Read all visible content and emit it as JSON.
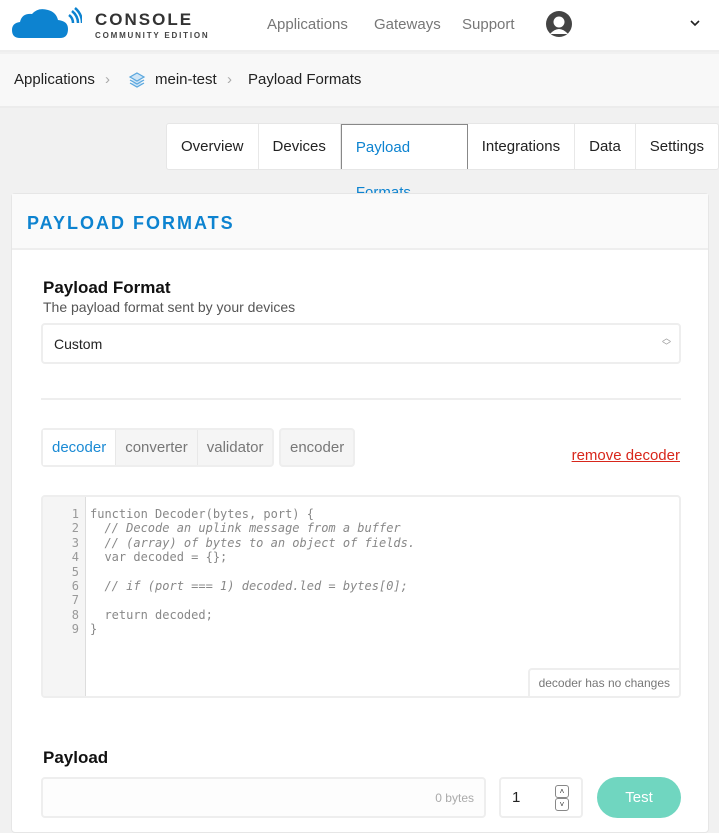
{
  "brand": {
    "title": "CONSOLE",
    "subtitle": "COMMUNITY EDITION",
    "color": "#0d83d0"
  },
  "nav": {
    "items": [
      "Applications",
      "Gateways",
      "Support"
    ],
    "avatar_icon": "user-avatar-icon",
    "menu_icon": "chevron-down-icon"
  },
  "breadcrumb": {
    "items": [
      "Applications",
      "mein-test",
      "Payload Formats"
    ],
    "app_icon": "layers-icon"
  },
  "tabs": [
    "Overview",
    "Devices",
    "Payload Formats",
    "Integrations",
    "Data",
    "Settings"
  ],
  "active_tab": "Payload Formats",
  "card": {
    "title": "PAYLOAD FORMATS"
  },
  "format": {
    "label": "Payload Format",
    "description": "The payload format sent by your devices",
    "selected": "Custom"
  },
  "functions": {
    "tabs": [
      "decoder",
      "converter",
      "validator"
    ],
    "encoder": "encoder",
    "active": "decoder",
    "remove": "remove decoder"
  },
  "editor": {
    "lines": [
      {
        "n": "1",
        "t": "function Decoder(bytes, port) {",
        "c": false
      },
      {
        "n": "2",
        "t": "  // Decode an uplink message from a buffer",
        "c": true
      },
      {
        "n": "3",
        "t": "  // (array) of bytes to an object of fields.",
        "c": true
      },
      {
        "n": "4",
        "t": "  var decoded = {};",
        "c": false
      },
      {
        "n": "5",
        "t": "",
        "c": false
      },
      {
        "n": "6",
        "t": "  // if (port === 1) decoded.led = bytes[0];",
        "c": true
      },
      {
        "n": "7",
        "t": "",
        "c": false
      },
      {
        "n": "8",
        "t": "  return decoded;",
        "c": false
      },
      {
        "n": "9",
        "t": "}",
        "c": false
      }
    ],
    "status": "decoder has no changes"
  },
  "payload": {
    "label": "Payload",
    "bytes": "0 bytes",
    "port": "1",
    "test": "Test",
    "test_color": "#70d6c0"
  }
}
